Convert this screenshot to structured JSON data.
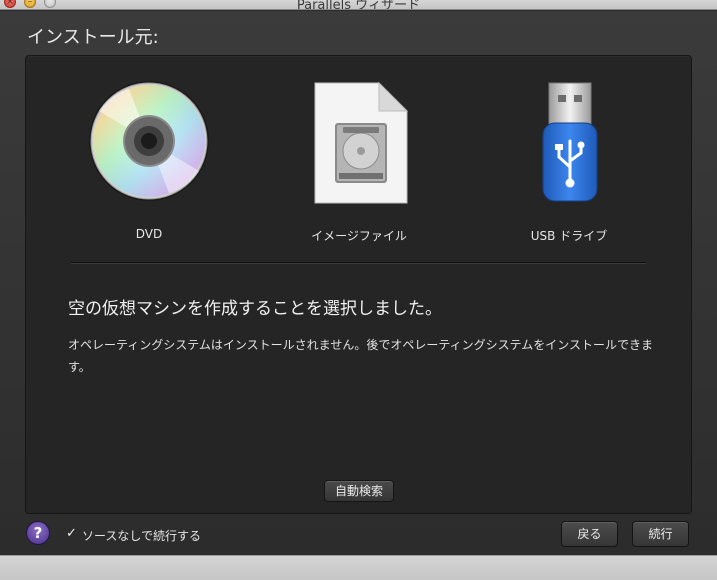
{
  "window": {
    "title": "Parallels ウィザード",
    "close_glyph": "×",
    "minimize_glyph": "–"
  },
  "heading": "インストール元:",
  "sources": [
    {
      "label": "DVD",
      "icon": "dvd-disc-icon"
    },
    {
      "label": "イメージファイル",
      "icon": "disk-image-file-icon"
    },
    {
      "label": "USB ドライブ",
      "icon": "usb-drive-icon"
    }
  ],
  "message": {
    "title": "空の仮想マシンを作成することを選択しました。",
    "body": "オペレーティングシステムはインストールされません。後でオペレーティングシステムをインストールできます。"
  },
  "buttons": {
    "auto_detect": "自動検索",
    "back": "戻る",
    "continue": "続行",
    "help": "?"
  },
  "options": {
    "continue_without_source": {
      "label": "ソースなしで続行する",
      "checked": true,
      "check_glyph": "✓"
    }
  },
  "colors": {
    "help_button": "#5b3fa0",
    "usb_blue": "#2f6fd0",
    "panel_bg": "#252525"
  }
}
